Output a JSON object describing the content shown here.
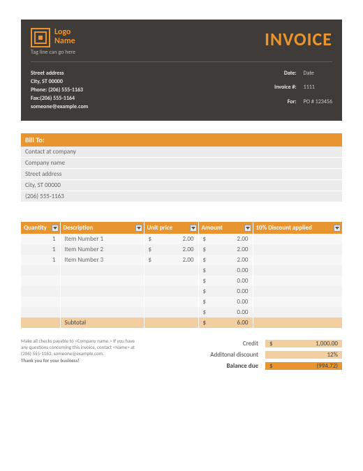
{
  "header": {
    "logo_line1": "Logo",
    "logo_line2": "Name",
    "tagline": "Tag line can go here",
    "title": "INVOICE",
    "address": {
      "street": "Street address",
      "city": "City, ST  00000",
      "phone": "Phone: (206) 555-1163",
      "fax": "Fax:(206) 555-1164",
      "email": "someone@example.com"
    },
    "meta": {
      "date_lbl": "Date:",
      "date_val": "Date",
      "invnum_lbl": "Invoice #:",
      "invnum_val": "1111",
      "for_lbl": "For:",
      "for_val": "PO # 123456"
    }
  },
  "billto": {
    "header": "Bill To:",
    "rows": [
      "Contact at company",
      "Company name",
      "Street address",
      "City, ST  00000",
      "(206) 555-1163"
    ]
  },
  "columns": {
    "qty": "Quantity",
    "desc": "Description",
    "unit": "Unit price",
    "amt": "Amount",
    "disc": "10% Discount applied"
  },
  "items": [
    {
      "qty": "1",
      "desc": "Item Number 1",
      "up": "2.00",
      "amt": "2.00",
      "disc": ""
    },
    {
      "qty": "1",
      "desc": "Item Number 2",
      "up": "2.00",
      "amt": "2.00",
      "disc": ""
    },
    {
      "qty": "1",
      "desc": "Item Number 3",
      "up": "2.00",
      "amt": "2.00",
      "disc": ""
    },
    {
      "qty": "",
      "desc": "",
      "up": "",
      "amt": "0.00",
      "disc": ""
    },
    {
      "qty": "",
      "desc": "",
      "up": "",
      "amt": "0.00",
      "disc": ""
    },
    {
      "qty": "",
      "desc": "",
      "up": "",
      "amt": "0.00",
      "disc": ""
    },
    {
      "qty": "",
      "desc": "",
      "up": "",
      "amt": "0.00",
      "disc": ""
    },
    {
      "qty": "",
      "desc": "",
      "up": "",
      "amt": "0.00",
      "disc": ""
    }
  ],
  "subtotal": {
    "label": "Subtotal",
    "value": "6.00"
  },
  "notes": {
    "line1": "Make all checks payable to <Company name.> If you have any questions concerning this invoice, contact <Name> at (206) 555-1163, someone@example.com.",
    "thanks": "Thank you for your business!"
  },
  "totals": {
    "credit_lbl": "Credit",
    "credit_val": "1,000.00",
    "disc_lbl": "Additonal discount",
    "disc_val": "12%",
    "due_lbl": "Balance due",
    "due_val": "(994.72)"
  },
  "currency": "$"
}
